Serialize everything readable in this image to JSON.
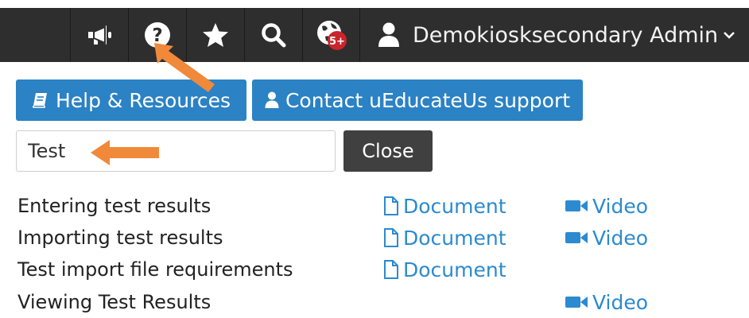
{
  "topbar": {
    "icons": [
      "megaphone-icon",
      "help-icon",
      "star-icon",
      "search-icon",
      "notifications-globe-icon"
    ],
    "notification_badge": "5+",
    "user_icon": "user-icon",
    "user_name": "Demokiosksecondary Admin",
    "menu_chevron": "chevron-down-icon"
  },
  "help_panel": {
    "resources_button": "Help & Resources",
    "support_button": "Contact uEducateUs support",
    "search_value": "Test",
    "close_button": "Close",
    "results": [
      {
        "title": "Entering test results",
        "document": "Document",
        "video": "Video"
      },
      {
        "title": "Importing test results",
        "document": "Document",
        "video": "Video"
      },
      {
        "title": "Test import file requirements",
        "document": "Document",
        "video": ""
      },
      {
        "title": "Viewing Test Results",
        "document": "",
        "video": "Video"
      }
    ]
  },
  "colors": {
    "topbar_bg": "#2e2e2e",
    "primary_button": "#2b82c4",
    "close_button": "#404040",
    "link": "#2c8ad0",
    "annotation_arrow": "#f0893a",
    "badge": "#c9252c"
  }
}
